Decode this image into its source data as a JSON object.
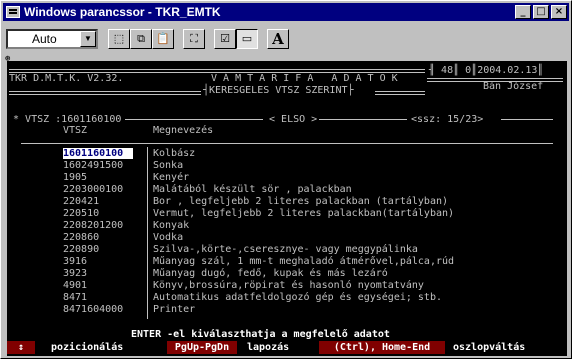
{
  "window": {
    "title": "Windows parancssor - TKR_EMTK",
    "buttons": [
      "_",
      "□",
      "×"
    ]
  },
  "toolbar": {
    "font_combo_value": "Auto",
    "buttons": [
      "mark-icon",
      "copy-icon",
      "paste-icon",
      "fullscreen-icon",
      "properties-icon",
      "background-icon",
      "font-icon"
    ],
    "font_button_label": "A"
  },
  "header": {
    "program": "TKR D.M.T.K. V2.32.",
    "app_title": "V Á M T A R I F A   A D A T O K",
    "subtitle": "KERESGELES VTSZ SZERINT",
    "counter": "48",
    "zero": "0",
    "date": "2004.02.13",
    "user": "Bán József"
  },
  "list_frame": {
    "search_label": "VTSZ :1601160100",
    "position_label": "ELSO",
    "ssz_label": "ssz: 15/23"
  },
  "columns": {
    "vtsz": "VTSZ",
    "name": "Megnevezés"
  },
  "rows": [
    {
      "code": "1601160100",
      "desc": "Kolbász",
      "selected": true
    },
    {
      "code": "1602491500",
      "desc": "Sonka"
    },
    {
      "code": "1905",
      "desc": "Kenyér"
    },
    {
      "code": "2203000100",
      "desc": "Malátából készült sör , palackban"
    },
    {
      "code": "220421",
      "desc": "Bor , legfeljebb 2 literes palackban (tartályban)"
    },
    {
      "code": "220510",
      "desc": "Vermut, legfeljebb 2 literes palackban(tartályban)"
    },
    {
      "code": "2208201200",
      "desc": "Konyak"
    },
    {
      "code": "220860",
      "desc": "Vodka"
    },
    {
      "code": "220890",
      "desc": "Szilva-,körte-,cseresznye- vagy meggypálinka"
    },
    {
      "code": "3916",
      "desc": "Műanyag szál, 1 mm-t meghaladó átmérővel,pálca,rúd"
    },
    {
      "code": "3923",
      "desc": "Műanyag dugó, fedő, kupak és más lezáró"
    },
    {
      "code": "4901",
      "desc": "Könyv,brossúra,röpirat és hasonló nyomtatvány"
    },
    {
      "code": "8471",
      "desc": "Automatikus adatfeldolgozó gép és egységei; stb."
    },
    {
      "code": "8471604000",
      "desc": "Printer"
    }
  ],
  "footer": {
    "hint": "ENTER -el kiválaszthatja a megfelelő adatot",
    "key1": "↕",
    "label1": "pozicionálás",
    "key2": "PgUp-PgDn",
    "label2": "lapozás",
    "key3": "(Ctrl), Home-End",
    "label3": "oszlopváltás"
  },
  "colors": {
    "titlebar": "#000080",
    "console_bg": "#000000",
    "console_fg": "#c0c0c0",
    "key_bg": "#800000",
    "selection_bg": "#ffffff"
  }
}
